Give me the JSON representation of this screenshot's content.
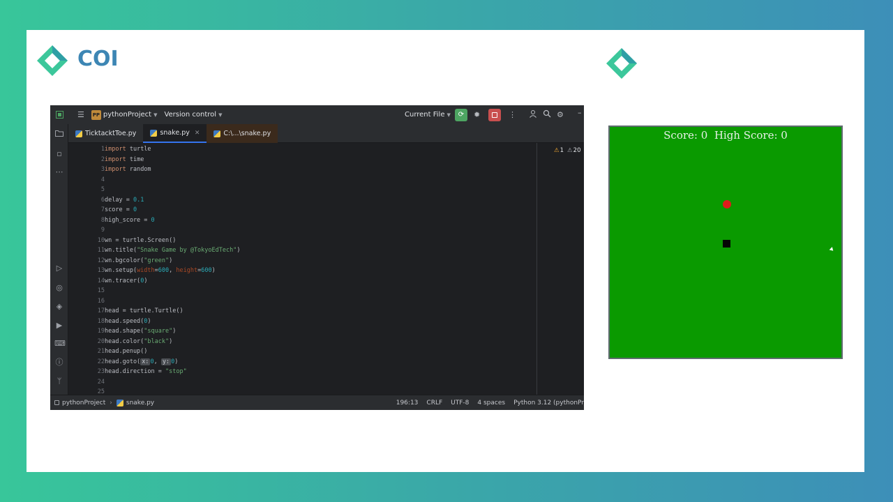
{
  "brand": {
    "name": "COI",
    "accent_color": "#3d86b4",
    "logo_icon": "diamond-logo-icon"
  },
  "ide": {
    "topbar": {
      "project_badge": "PP",
      "project_name": "pythonProject",
      "version_control": "Version control",
      "run_config": "Current File"
    },
    "tabs": [
      {
        "label": "TicktacktToe.py",
        "active": false
      },
      {
        "label": "snake.py",
        "active": true
      },
      {
        "label": "C:\\...\\snake.py",
        "active": false
      }
    ],
    "inspections": {
      "warnings": "1",
      "weak_warnings": "20"
    },
    "code_lines": [
      {
        "n": "1"
      },
      {
        "n": "2"
      },
      {
        "n": "3"
      },
      {
        "n": "4"
      },
      {
        "n": "5"
      },
      {
        "n": "6"
      },
      {
        "n": "7"
      },
      {
        "n": "8"
      },
      {
        "n": "9"
      },
      {
        "n": "10"
      },
      {
        "n": "11"
      },
      {
        "n": "12"
      },
      {
        "n": "13"
      },
      {
        "n": "14"
      },
      {
        "n": "15"
      },
      {
        "n": "16"
      },
      {
        "n": "17"
      },
      {
        "n": "18"
      },
      {
        "n": "19"
      },
      {
        "n": "20"
      },
      {
        "n": "21"
      },
      {
        "n": "22"
      },
      {
        "n": "23"
      },
      {
        "n": "24"
      },
      {
        "n": "25"
      }
    ],
    "code": {
      "l1_kw": "import",
      "l1_rest": " turtle",
      "l2_kw": "import",
      "l2_rest": " time",
      "l3_kw": "import",
      "l3_rest": " random",
      "l6_a": "delay = ",
      "l6_n": "0.1",
      "l7_a": "score = ",
      "l7_n": "0",
      "l8_a": "high_score = ",
      "l8_n": "0",
      "l10": "wn = turtle.Screen()",
      "l11_a": "wn.title(",
      "l11_s": "\"Snake Game by @TokyoEdTech\"",
      "l11_b": ")",
      "l12_a": "wn.bgcolor(",
      "l12_s": "\"green\"",
      "l12_b": ")",
      "l13_a": "wn.setup(",
      "l13_p1": "width",
      "l13_e1": "=",
      "l13_n1": "600",
      "l13_c": ", ",
      "l13_p2": "height",
      "l13_e2": "=",
      "l13_n2": "600",
      "l13_b": ")",
      "l14_a": "wn.tracer(",
      "l14_n": "0",
      "l14_b": ")",
      "l17": "head = turtle.Turtle()",
      "l18_a": "head.speed(",
      "l18_n": "0",
      "l18_b": ")",
      "l19_a": "head.shape(",
      "l19_s": "\"square\"",
      "l19_b": ")",
      "l20_a": "head.color(",
      "l20_s": "\"black\"",
      "l20_b": ")",
      "l21": "head.penup()",
      "l22_a": "head.goto(",
      "l22_h1": "x:",
      "l22_n1": "0",
      "l22_c": ", ",
      "l22_h2": "y:",
      "l22_n2": "0",
      "l22_b": ")",
      "l23_a": "head.direction = ",
      "l23_s": "\"stop\""
    },
    "status": {
      "project": "pythonProject",
      "file": "snake.py",
      "position": "196:13",
      "line_sep": "CRLF",
      "encoding": "UTF-8",
      "indent": "4 spaces",
      "interpreter": "Python 3.12 (pythonPr"
    }
  },
  "game": {
    "score_text": "Score: 0  High Score: 0",
    "bg_color": "#0a9a00",
    "food_color": "#e01b1b",
    "head_color": "#050505"
  }
}
